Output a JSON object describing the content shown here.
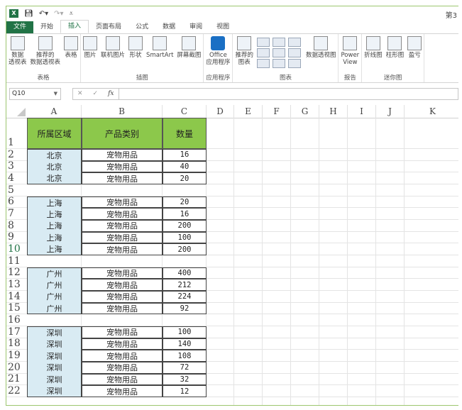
{
  "title": "第3",
  "tabs": [
    "文件",
    "开始",
    "插入",
    "页面布局",
    "公式",
    "数据",
    "审阅",
    "视图"
  ],
  "active_tab": "插入",
  "ribbon": {
    "groups": [
      {
        "label": "表格",
        "buttons": [
          "数据\n透视表",
          "推荐的\n数据透视表",
          "表格"
        ]
      },
      {
        "label": "插图",
        "buttons": [
          "图片",
          "联机图片",
          "形状",
          "SmartArt",
          "屏幕截图"
        ]
      },
      {
        "label": "应用程序",
        "buttons": [
          "Office\n应用程序"
        ]
      },
      {
        "label": "图表",
        "buttons": [
          "推荐的\n图表",
          "数据透视图"
        ]
      },
      {
        "label": "报告",
        "buttons": [
          "Power\nView"
        ]
      },
      {
        "label": "迷你图",
        "buttons": [
          "折线图",
          "柱形图",
          "盈亏"
        ]
      }
    ]
  },
  "name_box": "Q10",
  "formula_icons": {
    "cancel": "✕",
    "enter": "✓",
    "fx": "fx"
  },
  "formula_value": "",
  "columns": [
    "A",
    "B",
    "C",
    "D",
    "E",
    "F",
    "G",
    "H",
    "I",
    "J",
    "K"
  ],
  "selected_row": 10,
  "header": [
    "所属区域",
    "产品类别",
    "数量"
  ],
  "rows": [
    {
      "n": 2,
      "region": "北京",
      "product": "宠物用品",
      "qty": "16"
    },
    {
      "n": 3,
      "region": "北京",
      "product": "宠物用品",
      "qty": "40"
    },
    {
      "n": 4,
      "region": "北京",
      "product": "宠物用品",
      "qty": "20"
    },
    {
      "n": 5
    },
    {
      "n": 6,
      "region": "上海",
      "product": "宠物用品",
      "qty": "20"
    },
    {
      "n": 7,
      "region": "上海",
      "product": "宠物用品",
      "qty": "16"
    },
    {
      "n": 8,
      "region": "上海",
      "product": "宠物用品",
      "qty": "200"
    },
    {
      "n": 9,
      "region": "上海",
      "product": "宠物用品",
      "qty": "100"
    },
    {
      "n": 10,
      "region": "上海",
      "product": "宠物用品",
      "qty": "200"
    },
    {
      "n": 11
    },
    {
      "n": 12,
      "region": "广州",
      "product": "宠物用品",
      "qty": "400"
    },
    {
      "n": 13,
      "region": "广州",
      "product": "宠物用品",
      "qty": "212"
    },
    {
      "n": 14,
      "region": "广州",
      "product": "宠物用品",
      "qty": "224"
    },
    {
      "n": 15,
      "region": "广州",
      "product": "宠物用品",
      "qty": "92"
    },
    {
      "n": 16
    },
    {
      "n": 17,
      "region": "深圳",
      "product": "宠物用品",
      "qty": "100"
    },
    {
      "n": 18,
      "region": "深圳",
      "product": "宠物用品",
      "qty": "140"
    },
    {
      "n": 19,
      "region": "深圳",
      "product": "宠物用品",
      "qty": "108"
    },
    {
      "n": 20,
      "region": "深圳",
      "product": "宠物用品",
      "qty": "72"
    },
    {
      "n": 21,
      "region": "深圳",
      "product": "宠物用品",
      "qty": "32"
    },
    {
      "n": 22,
      "region": "深圳",
      "product": "宠物用品",
      "qty": "12"
    }
  ]
}
